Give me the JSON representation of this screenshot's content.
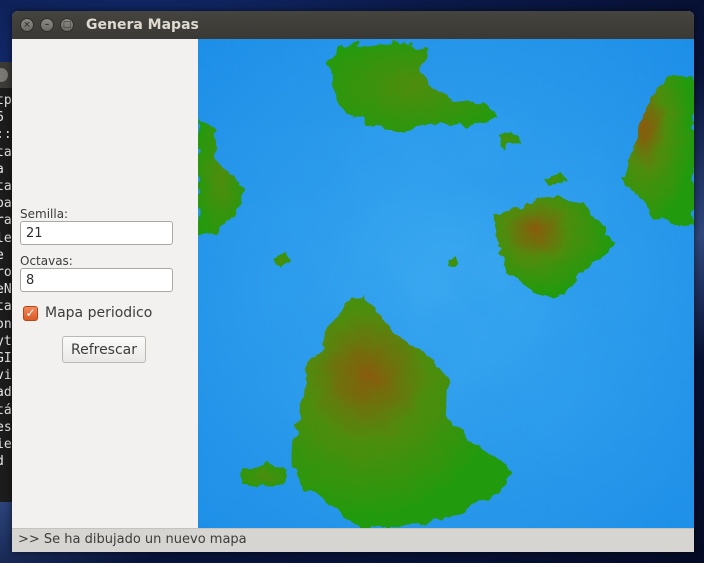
{
  "window": {
    "title": "Genera Mapas",
    "buttons": {
      "close": "×",
      "minimize": "–",
      "maximize": "□"
    }
  },
  "background_terminal": {
    "visible_chars": [
      "tp",
      "6",
      "::",
      "ta",
      "a",
      "ta",
      "pa",
      "ra",
      "le",
      "e",
      "ro",
      "eN",
      "ta",
      "on",
      "yt",
      "GI",
      "vi",
      "ad",
      "tá",
      "es",
      "ie",
      "d"
    ]
  },
  "controls": {
    "seed_label": "Semilla:",
    "seed_value": "21",
    "octaves_label": "Octavas:",
    "octaves_value": "8",
    "periodic_label": "Mapa periodico",
    "periodic_checked": true,
    "refresh_label": "Refrescar"
  },
  "map": {
    "colors": {
      "deep_water": "#0b63d8",
      "shallow_water": "#1e8fe8",
      "coast_water": "#3aa8f0",
      "lowland": "#249a0a",
      "midland": "#4f8c08",
      "highland": "#8a5a08"
    }
  },
  "status": {
    "message": ">>  Se ha dibujado un nuevo mapa"
  }
}
